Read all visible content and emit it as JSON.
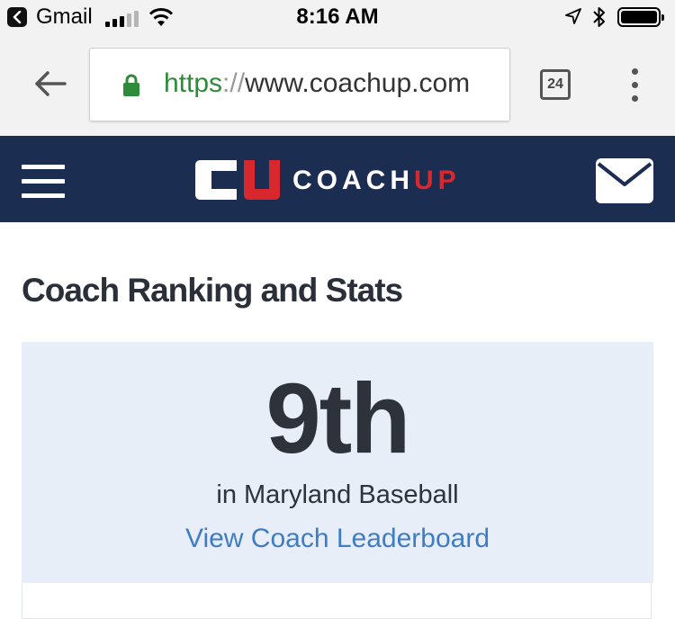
{
  "status_bar": {
    "back_app": "Gmail",
    "time": "8:16 AM",
    "icons": [
      "back-app-icon",
      "signal-icon",
      "wifi-icon",
      "location-icon",
      "bluetooth-icon",
      "battery-icon"
    ]
  },
  "browser": {
    "url_scheme": "https",
    "url_sep": "://",
    "url_host": "www.coachup.com",
    "tab_count": "24",
    "icons": [
      "back-arrow-icon",
      "lock-icon",
      "more-menu-icon"
    ],
    "colors": {
      "secure": "#2e8b3a",
      "bar": "#f2f2f2"
    }
  },
  "site": {
    "brand_coach": "COACH",
    "brand_up": "UP",
    "icons": [
      "hamburger-menu-icon",
      "coachup-logo-mark",
      "mail-icon"
    ],
    "colors": {
      "header": "#1c2d52",
      "accent": "#d9272e",
      "link": "#3f7cc6",
      "card": "#e7eef7"
    }
  },
  "main": {
    "title": "Coach Ranking and Stats",
    "rank": "9th",
    "rank_context": "in Maryland Baseball",
    "leaderboard_link": "View Coach Leaderboard"
  }
}
